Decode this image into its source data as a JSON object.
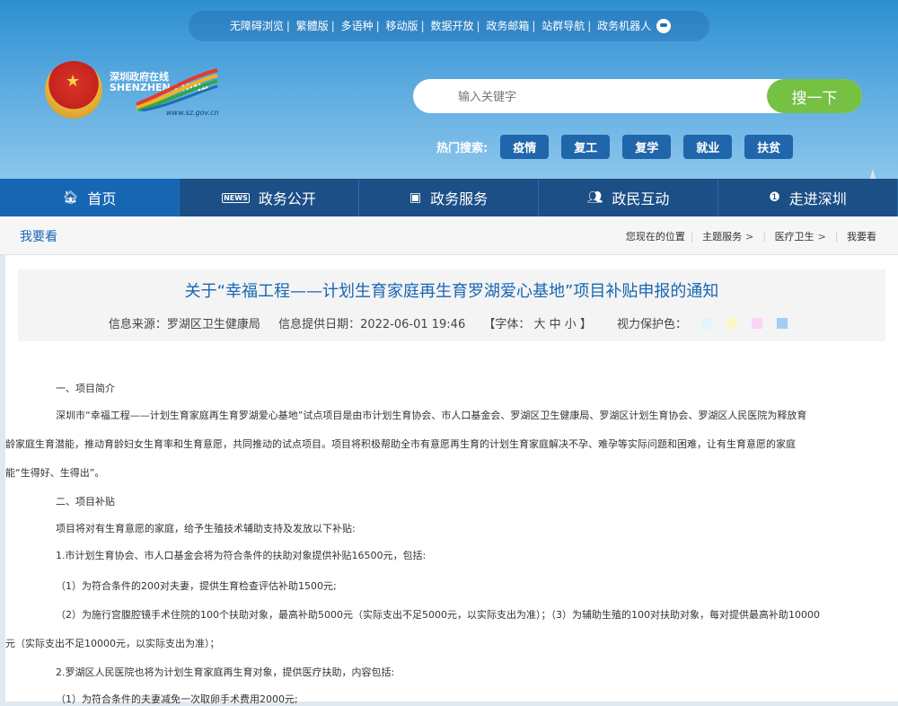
{
  "topbar": {
    "items": [
      "无障碍浏览",
      "繁體版",
      "多语种",
      "移动版",
      "数据开放",
      "政务邮箱",
      "站群导航",
      "政务机器人"
    ]
  },
  "logo": {
    "cn": "深圳政府在线",
    "en": "SHENZHEN CHINA",
    "url": "www.sz.gov.cn"
  },
  "search": {
    "placeholder": "输入关键字",
    "button": "搜一下"
  },
  "hot": {
    "label": "热门搜索:",
    "tags": [
      "疫情",
      "复工",
      "复学",
      "就业",
      "扶贫"
    ]
  },
  "nav": {
    "items": [
      "首页",
      "政务公开",
      "政务服务",
      "政民互动",
      "走进深圳"
    ]
  },
  "breadcrumb": {
    "section": "我要看",
    "location_label": "您现在的位置",
    "path": [
      "主题服务",
      "医疗卫生",
      "我要看"
    ]
  },
  "article": {
    "title": "关于“幸福工程——计划生育家庭再生育罗湖爱心基地”项目补贴申报的通知",
    "source": "信息来源：罗湖区卫生健康局",
    "date": "信息提供日期：2022-06-01 19:46",
    "font_size": "【字体： 大  中  小 】",
    "eye_care": "视力保护色：",
    "swatches": [
      "#e0f5fc",
      "#fbf8c8",
      "#f9d5f8",
      "#9fcdf5"
    ],
    "paragraphs": [
      "一、项目简介",
      "深圳市“幸福工程——计划生育家庭再生育罗湖爱心基地”试点项目是由市计划生育协会、市人口基金会、罗湖区卫生健康局、罗湖区计划生育协会、罗湖区人民医院为释放育",
      "龄家庭生育潜能，推动育龄妇女生育率和生育意愿，共同推动的试点项目。项目将积极帮助全市有意愿再生育的计划生育家庭解决不孕、难孕等实际问题和困难，让有生育意愿的家庭",
      "能“生得好、生得出”。",
      "二、项目补贴",
      "项目将对有生育意愿的家庭，给予生殖技术辅助支持及发放以下补贴:",
      "1.市计划生育协会、市人口基金会将为符合条件的扶助对象提供补贴16500元，包括:",
      "（1）为符合条件的200对夫妻，提供生育检查评估补助1500元;",
      "（2）为施行宫腹腔镜手术住院的100个扶助对象，最高补助5000元（实际支出不足5000元，以实际支出为准）；（3）为辅助生殖的100对扶助对象，每对提供最高补助10000",
      "元（实际支出不足10000元，以实际支出为准）；",
      "2.罗湖区人民医院也将为计划生育家庭再生育对象，提供医疗扶助，内容包括:",
      "（1）为符合条件的夫妻减免一次取卵手术费用2000元;"
    ]
  }
}
